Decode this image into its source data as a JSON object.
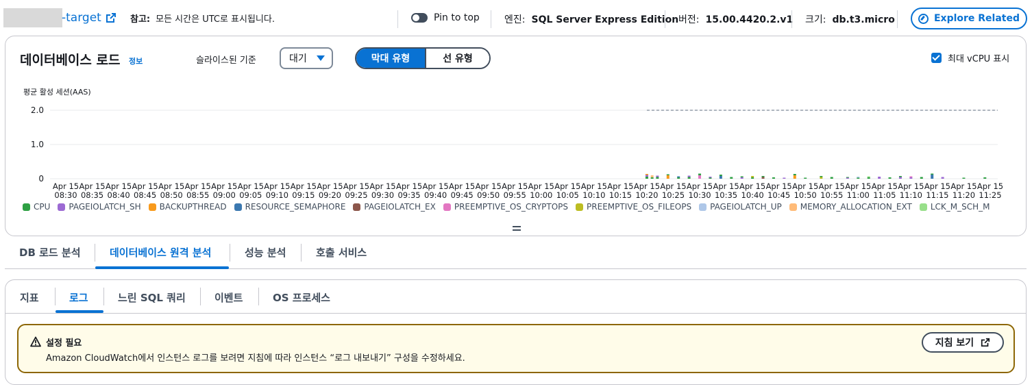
{
  "header": {
    "instance_suffix": "-target",
    "reference_label": "참고:",
    "reference_text": "모든 시간은 UTC로 표시됩니다.",
    "pin_label": "Pin to top",
    "engine_key": "엔진:",
    "engine_value": "SQL Server Express Edition",
    "version_key": "버전:",
    "version_value": "15.00.4420.2.v1",
    "size_key": "크기:",
    "size_value": "db.t3.micro",
    "explore_label": "Explore Related"
  },
  "load_panel": {
    "title": "데이터베이스 로드",
    "info_label": "정보",
    "sliced_by_label": "슬라이스된 기준",
    "sliced_by_value": "대기",
    "view_bar_label": "막대 유형",
    "view_line_label": "선 유형",
    "max_vcpu_label": "최대 vCPU 표시",
    "max_vcpu_checked": true
  },
  "chart_data": {
    "type": "bar",
    "stacked": true,
    "ylabel": "평균 활성 세션(AAS)",
    "yticks": [
      "2.0",
      "1.0",
      "0"
    ],
    "ylim": [
      0,
      2.0
    ],
    "max_vcpu_line": 2.0,
    "max_vcpu_line_from": "10:20",
    "x_date_label": "Apr 15",
    "x_ticks": [
      "08:30",
      "08:35",
      "08:40",
      "08:45",
      "08:50",
      "08:55",
      "09:00",
      "09:05",
      "09:10",
      "09:15",
      "09:20",
      "09:25",
      "09:30",
      "09:35",
      "09:40",
      "09:45",
      "09:50",
      "09:55",
      "10:00",
      "10:05",
      "10:10",
      "10:15",
      "10:20",
      "10:25",
      "10:30",
      "10:35",
      "10:40",
      "10:45",
      "10:50",
      "10:55",
      "11:00",
      "11:05",
      "11:10",
      "11:15",
      "11:20",
      "11:25"
    ],
    "legend": [
      {
        "name": "CPU",
        "color": "#2ea043"
      },
      {
        "name": "PAGEIOLATCH_SH",
        "color": "#9c6ad3"
      },
      {
        "name": "BACKUPTHREAD",
        "color": "#f89a1c"
      },
      {
        "name": "RESOURCE_SEMAPHORE",
        "color": "#3b78b0"
      },
      {
        "name": "PAGEIOLATCH_EX",
        "color": "#8c564b"
      },
      {
        "name": "PREEMPTIVE_OS_CRYPTOPS",
        "color": "#e377c2"
      },
      {
        "name": "PREEMPTIVE_OS_FILEOPS",
        "color": "#bcbd22"
      },
      {
        "name": "PAGEIOLATCH_UP",
        "color": "#aec7e8"
      },
      {
        "name": "MEMORY_ALLOCATION_EXT",
        "color": "#ffbb78"
      },
      {
        "name": "LCK_M_SCH_M",
        "color": "#98df8a"
      }
    ],
    "bars": [
      {
        "x": "10:20",
        "CPU": 0.06,
        "PAGEIOLATCH_SH": 0.05,
        "BACKUPTHREAD": 0.03
      },
      {
        "x": "10:21",
        "CPU": 0.04,
        "MEMORY_ALLOCATION_EXT": 0.06
      },
      {
        "x": "10:22",
        "CPU": 0.05,
        "PAGEIOLATCH_SH": 0.04
      },
      {
        "x": "10:24",
        "BACKUPTHREAD": 0.1,
        "CPU": 0.03
      },
      {
        "x": "10:26",
        "CPU": 0.04,
        "RESOURCE_SEMAPHORE": 0.03
      },
      {
        "x": "10:28",
        "CPU": 0.05,
        "PAGEIOLATCH_SH": 0.04
      },
      {
        "x": "10:30",
        "PREEMPTIVE_OS_CRYPTOPS": 0.1,
        "CPU": 0.05
      },
      {
        "x": "10:32",
        "CPU": 0.03,
        "PAGEIOLATCH_SH": 0.03
      },
      {
        "x": "10:34",
        "RESOURCE_SEMAPHORE": 0.08,
        "CPU": 0.04
      },
      {
        "x": "10:36",
        "CPU": 0.05
      },
      {
        "x": "10:38",
        "PAGEIOLATCH_SH": 0.04,
        "CPU": 0.03
      },
      {
        "x": "10:40",
        "CPU": 0.04,
        "PREEMPTIVE_OS_FILEOPS": 0.04
      },
      {
        "x": "10:42",
        "PAGEIOLATCH_EX": 0.05,
        "CPU": 0.03
      },
      {
        "x": "10:44",
        "CPU": 0.04
      },
      {
        "x": "10:46",
        "PAGEIOLATCH_SH": 0.03
      },
      {
        "x": "10:48",
        "BACKUPTHREAD": 0.1,
        "CPU": 0.04
      },
      {
        "x": "10:50",
        "CPU": 0.03
      },
      {
        "x": "10:53",
        "PREEMPTIVE_OS_FILEOPS": 0.05,
        "CPU": 0.03
      },
      {
        "x": "10:55",
        "CPU": 0.05
      },
      {
        "x": "10:58",
        "PAGEIOLATCH_SH": 0.03,
        "CPU": 0.02
      },
      {
        "x": "11:00",
        "CPU": 0.03,
        "PAGEIOLATCH_UP": 0.03
      },
      {
        "x": "11:02",
        "CPU": 0.04,
        "LCK_M_SCH_M": 0.03
      },
      {
        "x": "11:04",
        "PAGEIOLATCH_SH": 0.06
      },
      {
        "x": "11:06",
        "CPU": 0.04
      },
      {
        "x": "11:08",
        "PAGEIOLATCH_SH": 0.05,
        "CPU": 0.03
      },
      {
        "x": "11:10",
        "PAGEIOLATCH_SH": 0.04,
        "PREEMPTIVE_OS_CRYPTOPS": 0.03
      },
      {
        "x": "11:12",
        "CPU": 0.05
      },
      {
        "x": "11:14",
        "RESOURCE_SEMAPHORE": 0.12,
        "CPU": 0.03
      },
      {
        "x": "11:16",
        "PAGEIOLATCH_SH": 0.05
      },
      {
        "x": "11:20",
        "CPU": 0.03
      },
      {
        "x": "11:24",
        "CPU": 0.04
      }
    ]
  },
  "main_tabs": [
    {
      "label": "DB 로드 분석",
      "active": false
    },
    {
      "label": "데이터베이스 원격 분석",
      "active": true
    },
    {
      "label": "성능 분석",
      "active": false
    },
    {
      "label": "호출 서비스",
      "active": false
    }
  ],
  "sub_tabs": [
    {
      "label": "지표",
      "active": false
    },
    {
      "label": "로그",
      "active": true
    },
    {
      "label": "느린 SQL 쿼리",
      "active": false
    },
    {
      "label": "이벤트",
      "active": false
    },
    {
      "label": "OS 프로세스",
      "active": false
    }
  ],
  "alert": {
    "title": "설정 필요",
    "body": "Amazon CloudWatch에서 인스턴스 로그를 보려면 지침에 따라 인스턴스 “로그 내보내기” 구성을 수정하세요.",
    "button_label": "지침 보기",
    "color_border": "#8d6605",
    "color_background": "#fffce9"
  }
}
